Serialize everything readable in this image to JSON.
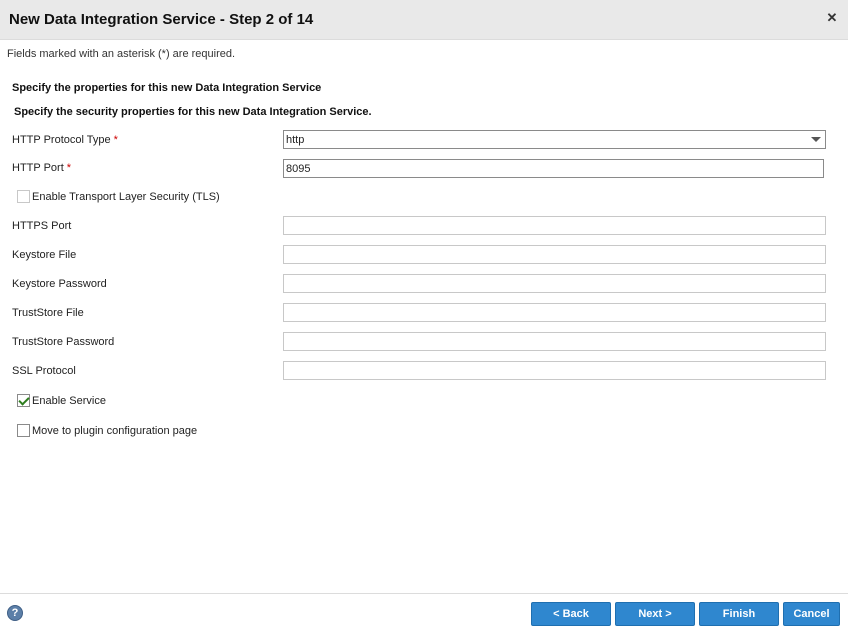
{
  "dialog": {
    "title": "New Data Integration Service - Step 2 of 14",
    "close_glyph": "✕"
  },
  "required_note": "Fields marked with an asterisk (*) are required.",
  "headings": {
    "properties": "Specify the properties for this new Data Integration Service",
    "security": "Specify the security properties for this new Data Integration Service."
  },
  "form": {
    "http_protocol_type": {
      "label": "HTTP Protocol Type",
      "required_mark": "*",
      "value": "http"
    },
    "http_port": {
      "label": "HTTP Port",
      "required_mark": "*",
      "value": "8095"
    },
    "enable_tls": {
      "label": "Enable Transport Layer Security (TLS)",
      "checked": false
    },
    "https_port": {
      "label": "HTTPS Port",
      "value": ""
    },
    "keystore_file": {
      "label": "Keystore File",
      "value": ""
    },
    "keystore_password": {
      "label": "Keystore Password",
      "value": ""
    },
    "truststore_file": {
      "label": "TrustStore File",
      "value": ""
    },
    "truststore_password": {
      "label": "TrustStore Password",
      "value": ""
    },
    "ssl_protocol": {
      "label": "SSL Protocol",
      "value": ""
    },
    "enable_service": {
      "label": "Enable Service",
      "checked": true
    },
    "move_to_plugin": {
      "label": "Move to plugin configuration page",
      "checked": false
    }
  },
  "footer": {
    "help_glyph": "?",
    "back_label": "< Back",
    "next_label": "Next >",
    "finish_label": "Finish",
    "cancel_label": "Cancel"
  },
  "colors": {
    "button_bg": "#2f87cf",
    "required_star": "#cc0000",
    "titlebar_bg": "#e9e9e9",
    "help_icon": "#5c7fa8"
  },
  "icons": [
    "close-icon",
    "caret-down-icon",
    "check-icon",
    "help-icon"
  ]
}
